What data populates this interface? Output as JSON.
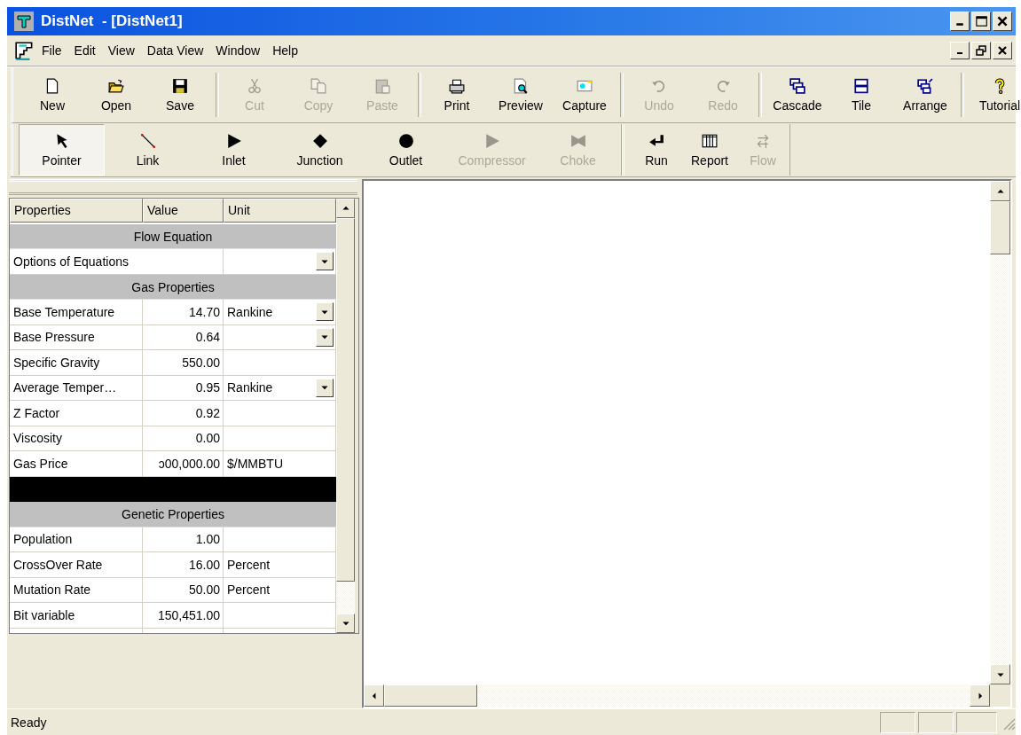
{
  "window": {
    "title": "DistNet  - [DistNet1]"
  },
  "menu": [
    "File",
    "Edit",
    "View",
    "Data View",
    "Window",
    "Help"
  ],
  "toolbar": [
    [
      {
        "label": "New",
        "kind": "new",
        "disabled": false
      },
      {
        "label": "Open",
        "kind": "open",
        "disabled": false
      },
      {
        "label": "Save",
        "kind": "save",
        "disabled": false
      }
    ],
    [
      {
        "label": "Cut",
        "kind": "cut",
        "disabled": true
      },
      {
        "label": "Copy",
        "kind": "copy",
        "disabled": true
      },
      {
        "label": "Paste",
        "kind": "paste",
        "disabled": true
      }
    ],
    [
      {
        "label": "Print",
        "kind": "print",
        "disabled": false
      },
      {
        "label": "Preview",
        "kind": "preview",
        "disabled": false
      },
      {
        "label": "Capture",
        "kind": "capture",
        "disabled": false
      }
    ],
    [
      {
        "label": "Undo",
        "kind": "undo",
        "disabled": true
      },
      {
        "label": "Redo",
        "kind": "redo",
        "disabled": true
      }
    ],
    [
      {
        "label": "Cascade",
        "kind": "cascade",
        "disabled": false
      },
      {
        "label": "Tile",
        "kind": "tile",
        "disabled": false
      },
      {
        "label": "Arrange",
        "kind": "arrange",
        "disabled": false
      }
    ],
    [
      {
        "label": "Tutorial",
        "kind": "tutorial",
        "disabled": false
      }
    ]
  ],
  "palette": [
    [
      {
        "label": "Pointer",
        "kind": "pointer",
        "selected": true,
        "disabled": false
      },
      {
        "label": "Link",
        "kind": "link",
        "selected": false,
        "disabled": false
      },
      {
        "label": "Inlet",
        "kind": "inlet",
        "selected": false,
        "disabled": false
      },
      {
        "label": "Junction",
        "kind": "junction",
        "selected": false,
        "disabled": false
      },
      {
        "label": "Outlet",
        "kind": "outlet",
        "selected": false,
        "disabled": false
      },
      {
        "label": "Compressor",
        "kind": "compressor",
        "selected": false,
        "disabled": true
      },
      {
        "label": "Choke",
        "kind": "choke",
        "selected": false,
        "disabled": true
      }
    ],
    [
      {
        "label": "Run",
        "kind": "run",
        "selected": false,
        "disabled": false
      },
      {
        "label": "Report",
        "kind": "report",
        "selected": false,
        "disabled": false
      },
      {
        "label": "Flow",
        "kind": "flow",
        "selected": false,
        "disabled": true
      }
    ]
  ],
  "properties": {
    "columns": [
      "Properties",
      "Value",
      "Unit"
    ],
    "rows": [
      {
        "kind": "section",
        "name": "Flow Equation"
      },
      {
        "kind": "row",
        "name": "Options of Equations",
        "dropdown": true,
        "span": true
      },
      {
        "kind": "section",
        "name": "Gas Properties"
      },
      {
        "kind": "row",
        "name": "Base Temperature",
        "value": "14.70",
        "unit": "Rankine",
        "dropdown": true
      },
      {
        "kind": "row",
        "name": "Base Pressure",
        "value": "0.64",
        "dropdown": true
      },
      {
        "kind": "row",
        "name": "Specific Gravity",
        "value": "550.00",
        "dropdown": false
      },
      {
        "kind": "row",
        "name": "Average Temper…",
        "value": "0.95",
        "unit": "Rankine",
        "dropdown": true
      },
      {
        "kind": "row",
        "name": "Z Factor",
        "value": "0.92",
        "dropdown": false
      },
      {
        "kind": "row",
        "name": "Viscosity",
        "value": "0.00",
        "dropdown": false
      },
      {
        "kind": "row",
        "name": "Gas Price",
        "value": "ↄ00,000.00",
        "unit": "$/MMBTU",
        "dropdown": false
      },
      {
        "kind": "blank"
      },
      {
        "kind": "section",
        "name": "Genetic Properties"
      },
      {
        "kind": "row",
        "name": "Population",
        "value": "1.00",
        "dropdown": false
      },
      {
        "kind": "row",
        "name": "CrossOver Rate",
        "value": "16.00",
        "unit": "Percent",
        "dropdown": false
      },
      {
        "kind": "row",
        "name": "Mutation Rate",
        "value": "50.00",
        "unit": "Percent",
        "dropdown": false
      },
      {
        "kind": "row",
        "name": "Bit variable",
        "value": "150,451.00",
        "dropdown": false
      }
    ]
  },
  "status_bar": {
    "text": "Ready"
  }
}
